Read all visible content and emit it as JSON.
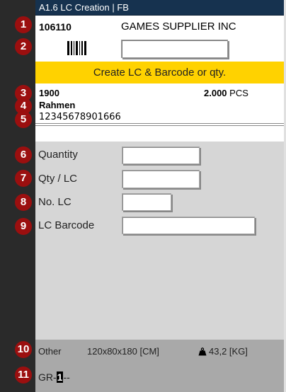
{
  "window": {
    "title": "A1.6 LC Creation | FB"
  },
  "header": {
    "doc_number": "106110",
    "supplier": "GAMES SUPPLIER INC",
    "barcode_icon": "barcode-icon",
    "supplier_input_value": ""
  },
  "banner": {
    "text": "Create LC & Barcode or qty."
  },
  "item": {
    "number": "1900",
    "quantity": "2.000",
    "unit": "PCS",
    "name": "Rahmen",
    "ean": "12345678901666"
  },
  "fields": {
    "quantity": {
      "label": "Quantity",
      "value": ""
    },
    "qty_per_lc": {
      "label": "Qty / LC",
      "value": ""
    },
    "no_lc": {
      "label": "No. LC",
      "value": ""
    },
    "lc_barcode": {
      "label": "LC Barcode",
      "value": ""
    }
  },
  "footer": {
    "type": "Other",
    "dimensions": "120x80x180 [CM]",
    "weight": "43,2 [KG]",
    "weight_icon": "weight-icon",
    "code_prefix": "GR-",
    "code_cursor": "1",
    "code_suffix": "--"
  },
  "badges": [
    "1",
    "2",
    "3",
    "4",
    "5",
    "6",
    "7",
    "8",
    "9",
    "10",
    "11"
  ],
  "colors": {
    "titlebar": "#16324f",
    "banner": "#ffd200",
    "badge": "#9b0f0f",
    "footer": "#a9a9a9",
    "panel": "#d6d6d6"
  }
}
